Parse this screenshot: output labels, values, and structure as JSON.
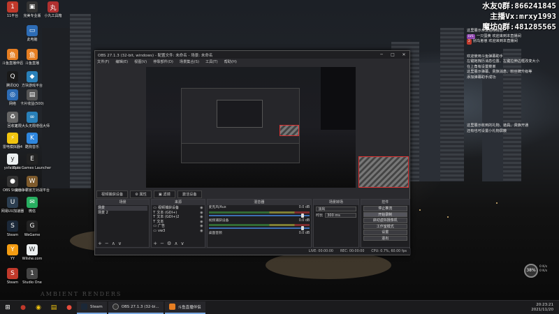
{
  "desktop_icons": [
    {
      "label": "11平台",
      "color": "#c0392b",
      "glyph": "1"
    },
    {
      "label": "完美专业版",
      "color": "#333333",
      "glyph": "▣"
    },
    {
      "label": "小丸工具箱",
      "color": "#b03030",
      "glyph": "丸"
    },
    {
      "label": "此电脑",
      "color": "#2d6cb5",
      "glyph": "▭"
    },
    {
      "label": "斗鱼直播伴侣",
      "color": "#e67e22",
      "glyph": "鱼"
    },
    {
      "label": "斗鱼直播",
      "color": "#e67e22",
      "glyph": "鱼"
    },
    {
      "label": "腾讯QQ",
      "color": "#1a1a1a",
      "glyph": "Q"
    },
    {
      "label": "方块游戏平台",
      "color": "#2980b9",
      "glyph": "◆"
    },
    {
      "label": "网络",
      "color": "#2d6cb5",
      "glyph": "◎"
    },
    {
      "label": "卡片收益(500)",
      "color": "#555555",
      "glyph": "▤"
    },
    {
      "label": "回收站",
      "color": "#666666",
      "glyph": "♻"
    },
    {
      "label": "无限大头无限增强大师",
      "color": "#2980b9",
      "glyph": "∞"
    },
    {
      "label": "雷电模拟器4",
      "color": "#f1c40f",
      "glyph": "⚡"
    },
    {
      "label": "酷狗音乐",
      "color": "#2e86de",
      "glyph": "K"
    },
    {
      "label": "yxfabu.cn",
      "color": "#ecf0f1",
      "glyph": "y"
    },
    {
      "label": "Epic Games Launcher",
      "color": "#222222",
      "glyph": "E"
    },
    {
      "label": "OBS Studio",
      "color": "#333333",
      "glyph": "●"
    },
    {
      "label": "魔兽争霸官方对战平台",
      "color": "#7d5a2c",
      "glyph": "W"
    },
    {
      "label": "网易UU加速器",
      "color": "#2c3e50",
      "glyph": "U"
    },
    {
      "label": "微信",
      "color": "#27ae60",
      "glyph": "✉"
    },
    {
      "label": "Steam",
      "color": "#1b2838",
      "glyph": "S"
    },
    {
      "label": "WeGame",
      "color": "#222222",
      "glyph": "G"
    },
    {
      "label": "YY",
      "color": "#f39c12",
      "glyph": "Y"
    },
    {
      "label": "Wilshe.com",
      "color": "#ecf0f1",
      "glyph": "W"
    },
    {
      "label": "Steam",
      "color": "#c0392b",
      "glyph": "S"
    },
    {
      "label": "Studio One",
      "color": "#444444",
      "glyph": "1"
    }
  ],
  "overlay": {
    "line1": "水友Q群:866241845",
    "line2": "主播Vx:mrxy1993",
    "line3": "魔坊Q群:481285565"
  },
  "chat": {
    "sys1": "这里展示水友进场消息",
    "msgs": [
      {
        "badge": "LV1",
        "badge_color": "#8e44ad",
        "text": "一只蛋黄 欢迎来到本直播间"
      },
      {
        "badge": "2",
        "badge_color": "#c0392b",
        "text": "别鸟崽崽 欢迎来到本直播间"
      }
    ],
    "sys2": "欢迎使用斗鱼弹幕助手",
    "sys3": "左键拖拽历消息位置、左键拉伸边框改变大小",
    "sys4": "在上角有设置菜单",
    "sys5": "这里展示弹幕、贵族消息、粉丝牌升级等",
    "sys6": "添加弹幕助手成功",
    "sys7": "这里展示收到的礼物、道具、贵族开通",
    "sys8": "还有也可设置小礼物屏蔽"
  },
  "obs": {
    "title": "OBS 27.1.3 (32-bit, windows) - 配置文件: 未命名 - 场景: 未命名",
    "menu": [
      "文件(F)",
      "编辑(E)",
      "视图(V)",
      "停靠部件(D)",
      "场景集合(S)",
      "工具(T)",
      "帮助(H)"
    ],
    "win_btns": [
      "─",
      "□",
      "✕"
    ],
    "tabs": [
      "视频捕获设备",
      "⚙ 属性",
      "▣ 滤镜",
      "激活设备"
    ],
    "scenes_header": "场景",
    "scenes": [
      "场景",
      "场景 2"
    ],
    "sources_header": "来源",
    "sources": [
      {
        "icon": "▭",
        "name": "视频捕获设备"
      },
      {
        "icon": "T",
        "name": "文本 (GDI+)"
      },
      {
        "icon": "T",
        "name": "文本 (GDI+)2"
      },
      {
        "icon": "T",
        "name": "文本"
      },
      {
        "icon": "▭",
        "name": "广告"
      },
      {
        "icon": "▭",
        "name": "vw3"
      }
    ],
    "mixer_header": "混音器",
    "mixer": [
      {
        "name": "麦克风/Aux",
        "db": "0.0 dB"
      },
      {
        "name": "视频捕获设备",
        "db": "0.0 dB"
      },
      {
        "name": "桌面音频",
        "db": "0.0 dB"
      }
    ],
    "transitions_header": "场景转场",
    "transition_value": "淡出",
    "duration_label": "时长",
    "duration_value": "300 ms",
    "controls_header": "控件",
    "controls": [
      "停止推流",
      "开始录制",
      "启动虚拟摄像机",
      "工作室模式",
      "设置",
      "退出"
    ],
    "status": {
      "live": "LIVE: 00:00:00",
      "rec": "REC: 00:00:00",
      "cpu": "CPU: 0.7%, 60.00 fps"
    },
    "add_remove": [
      "+",
      "−",
      "⚙",
      "∧",
      "∨"
    ]
  },
  "widgets": {
    "speed": "38%",
    "net_up": "0 K/s",
    "net_down": "0 K/s"
  },
  "watermark": "AMBIENT RENDERS",
  "taskbar": {
    "apps": [
      {
        "label": "Steam",
        "color": "#1b2838"
      },
      {
        "label": "OBS 27.1.3 (32-bi...",
        "color": "#333333"
      },
      {
        "label": "斗鱼直播伴侣",
        "color": "#e67e22"
      }
    ],
    "time": "20:23:21",
    "date": "2021/11/20"
  }
}
